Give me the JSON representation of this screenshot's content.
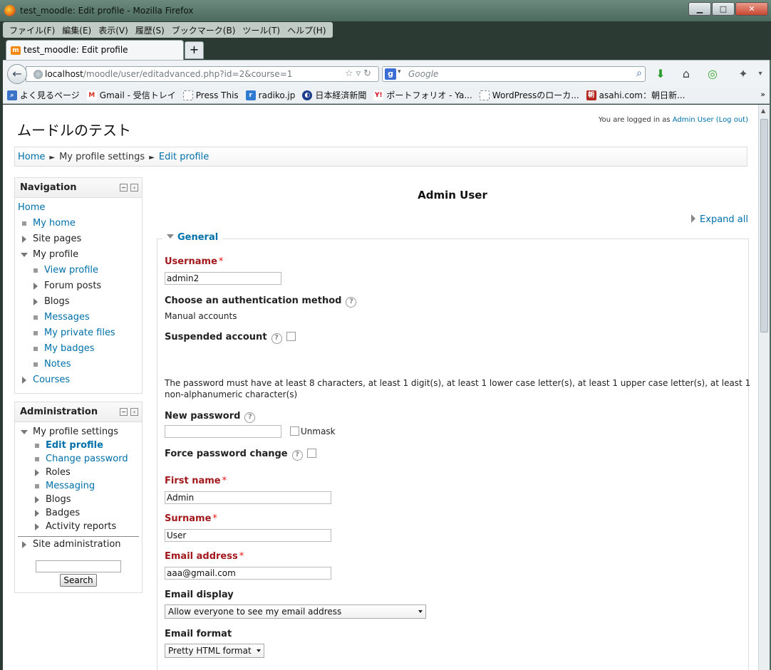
{
  "window": {
    "title": "test_moodle: Edit profile - Mozilla Firefox",
    "minimize": "▁",
    "maximize": "□",
    "close": "✕"
  },
  "menu": [
    "ファイル(F)",
    "編集(E)",
    "表示(V)",
    "履歴(S)",
    "ブックマーク(B)",
    "ツール(T)",
    "ヘルプ(H)"
  ],
  "tab": {
    "label": "test_moodle: Edit profile",
    "new_tab": "+"
  },
  "address": {
    "host": "localhost",
    "path": "/moodle/user/editadvanced.php?id=2&course=1",
    "search_placeholder": "Google"
  },
  "bookmarks": [
    {
      "label": "よく見るページ",
      "icon": "most-visited-icon",
      "color": "#3a73c8"
    },
    {
      "label": "Gmail - 受信トレイ",
      "icon": "gmail-icon",
      "color": "#d93025"
    },
    {
      "label": "Press This",
      "icon": "page-icon",
      "color": "#ffffff"
    },
    {
      "label": "radiko.jp",
      "icon": "radiko-icon",
      "color": "#2f7bd1"
    },
    {
      "label": "日本経済新聞",
      "icon": "nikkei-icon",
      "color": "#1a3c8a"
    },
    {
      "label": "ポートフォリオ - Ya...",
      "icon": "yahoo-icon",
      "color": "#d0021b"
    },
    {
      "label": "WordPressのローカ...",
      "icon": "page-icon",
      "color": "#ffffff"
    },
    {
      "label": "asahi.com：朝日新...",
      "icon": "asahi-icon",
      "color": "#b3261e"
    }
  ],
  "site": {
    "title": "ムードルのテスト",
    "login_prefix": "You are logged in as",
    "login_user": "Admin User",
    "logout": "(Log out)"
  },
  "breadcrumb": {
    "home": "Home",
    "middle": "My profile settings",
    "current": "Edit profile",
    "sep": "►"
  },
  "navigation": {
    "title": "Navigation",
    "home": "Home",
    "my_home": "My home",
    "site_pages": "Site pages",
    "my_profile": "My profile",
    "view_profile": "View profile",
    "forum_posts": "Forum posts",
    "blogs": "Blogs",
    "messages": "Messages",
    "my_private_files": "My private files",
    "my_badges": "My badges",
    "notes": "Notes",
    "courses": "Courses"
  },
  "administration": {
    "title": "Administration",
    "my_profile_settings": "My profile settings",
    "edit_profile": "Edit profile",
    "change_password": "Change password",
    "roles": "Roles",
    "messaging": "Messaging",
    "blogs": "Blogs",
    "badges": "Badges",
    "activity_reports": "Activity reports",
    "site_administration": "Site administration",
    "search_button": "Search"
  },
  "form": {
    "heading": "Admin User",
    "expand_all": "Expand all",
    "section": "General",
    "username_label": "Username",
    "username_value": "admin2",
    "auth_label": "Choose an authentication method",
    "auth_value": "Manual accounts",
    "suspended_label": "Suspended account",
    "password_rules_1": "The password must have at least 8 characters, at least 1 digit(s), at least 1 lower case letter(s), at least 1 upper case letter(s), at least 1",
    "password_rules_2": "non-alphanumeric character(s)",
    "new_password_label": "New password",
    "new_password_value": "",
    "unmask_label": "Unmask",
    "force_change_label": "Force password change",
    "firstname_label": "First name",
    "firstname_value": "Admin",
    "surname_label": "Surname",
    "surname_value": "User",
    "email_label": "Email address",
    "email_value": "aaa@gmail.com",
    "email_display_label": "Email display",
    "email_display_value": "Allow everyone to see my email address",
    "email_format_label": "Email format",
    "email_format_value": "Pretty HTML format",
    "required_mark": "*",
    "help_mark": "?"
  }
}
